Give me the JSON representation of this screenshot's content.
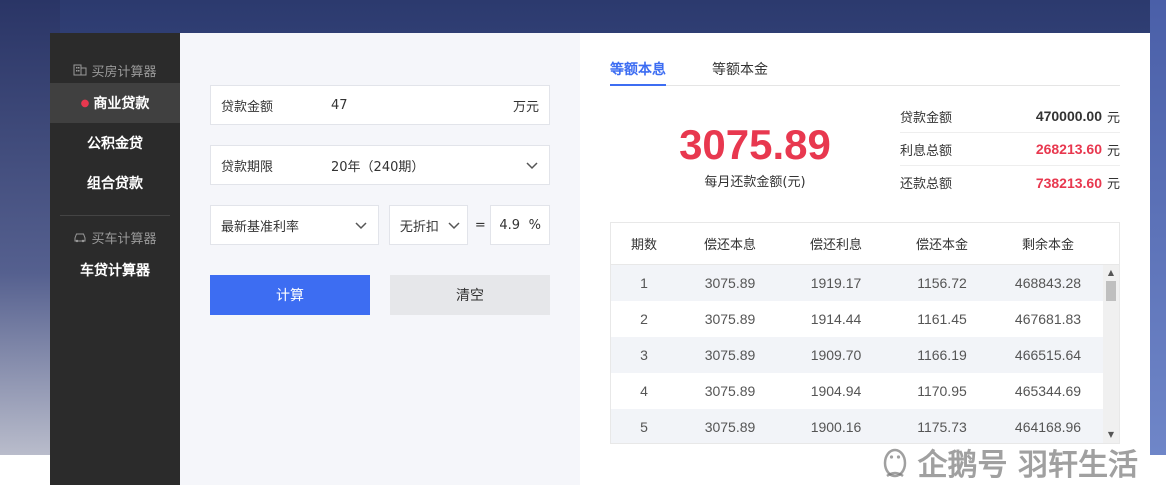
{
  "sidebar": {
    "group1": {
      "label": "买房计算器",
      "icon": "building-icon"
    },
    "items": [
      {
        "label": "商业贷款",
        "active": true
      },
      {
        "label": "公积金贷",
        "active": false
      },
      {
        "label": "组合贷款",
        "active": false
      }
    ],
    "group2": {
      "label": "买车计算器",
      "icon": "car-icon"
    },
    "car_items": [
      {
        "label": "车贷计算器"
      }
    ]
  },
  "form": {
    "amount": {
      "label": "贷款金额",
      "value": "47",
      "unit": "万元"
    },
    "term": {
      "label": "贷款期限",
      "value": "20年（240期）"
    },
    "rate_type": "最新基准利率",
    "discount": "无折扣",
    "equals": "=",
    "rate_value": "4.9",
    "rate_unit": "%",
    "calc_label": "计算",
    "clear_label": "清空"
  },
  "result": {
    "tabs": [
      {
        "label": "等额本息",
        "active": true
      },
      {
        "label": "等额本金",
        "active": false
      }
    ],
    "monthly_payment": "3075.89",
    "monthly_caption": "每月还款金额(元)",
    "totals": [
      {
        "label": "贷款金额",
        "value": "470000.00",
        "unit": "元",
        "highlight": false
      },
      {
        "label": "利息总额",
        "value": "268213.60",
        "unit": "元",
        "highlight": true
      },
      {
        "label": "还款总额",
        "value": "738213.60",
        "unit": "元",
        "highlight": true
      }
    ],
    "table": {
      "headers": [
        "期数",
        "偿还本息",
        "偿还利息",
        "偿还本金",
        "剩余本金"
      ],
      "rows": [
        [
          "1",
          "3075.89",
          "1919.17",
          "1156.72",
          "468843.28"
        ],
        [
          "2",
          "3075.89",
          "1914.44",
          "1161.45",
          "467681.83"
        ],
        [
          "3",
          "3075.89",
          "1909.70",
          "1166.19",
          "466515.64"
        ],
        [
          "4",
          "3075.89",
          "1904.94",
          "1170.95",
          "465344.69"
        ],
        [
          "5",
          "3075.89",
          "1900.16",
          "1175.73",
          "464168.96"
        ]
      ]
    }
  },
  "watermark": "企鹅号 羽轩生活",
  "colors": {
    "accent": "#3d6df2",
    "highlight": "#e8384f",
    "sidebar": "#2b2b2b"
  }
}
